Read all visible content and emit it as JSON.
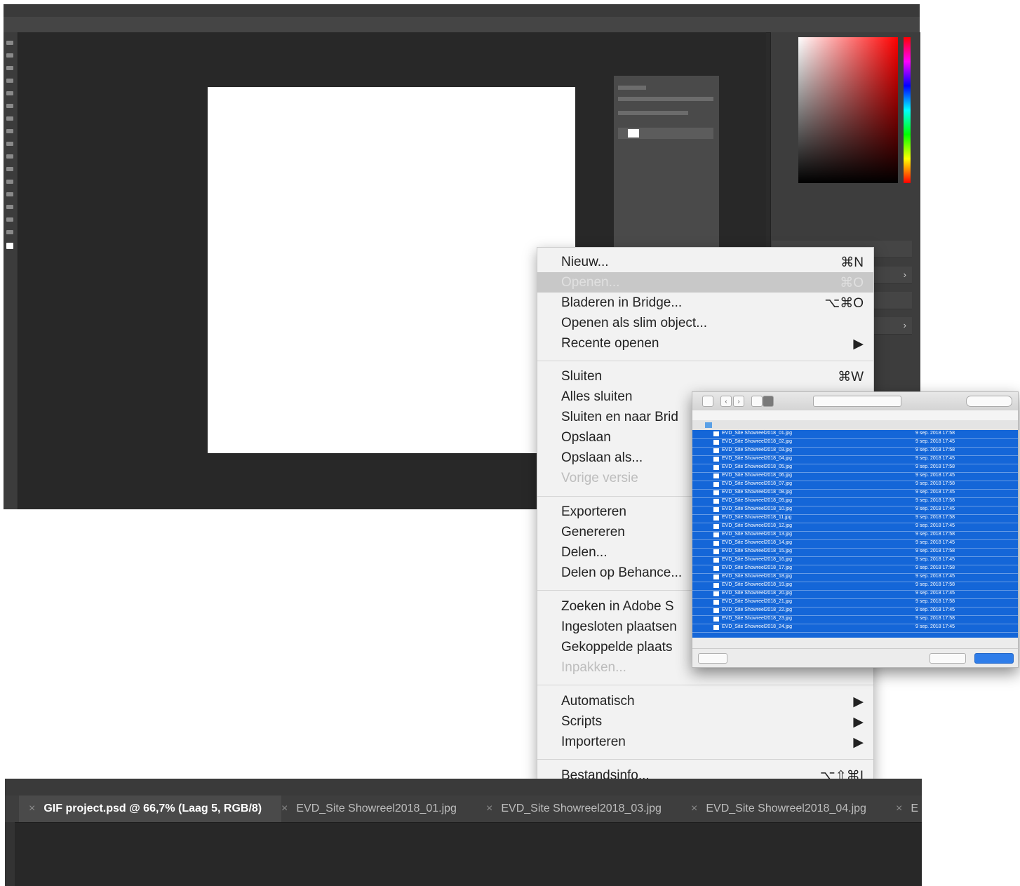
{
  "photoshop": {
    "right_dock_arrows": [
      "›",
      "›"
    ]
  },
  "file_menu": {
    "items": [
      {
        "label": "Nieuw...",
        "shortcut": "⌘N"
      },
      {
        "label": "Openen...",
        "shortcut": "⌘O"
      },
      {
        "label": "Bladeren in Bridge...",
        "shortcut": "⌥⌘O"
      },
      {
        "label": "Openen als slim object...",
        "shortcut": ""
      },
      {
        "label": "Recente openen",
        "shortcut": "▶"
      },
      {
        "label": "Sluiten",
        "shortcut": "⌘W"
      },
      {
        "label": "Alles sluiten",
        "shortcut": ""
      },
      {
        "label": "Sluiten en naar Brid",
        "shortcut": ""
      },
      {
        "label": "Opslaan",
        "shortcut": ""
      },
      {
        "label": "Opslaan als...",
        "shortcut": ""
      },
      {
        "label": "Vorige versie",
        "shortcut": ""
      },
      {
        "label": "Exporteren",
        "shortcut": ""
      },
      {
        "label": "Genereren",
        "shortcut": ""
      },
      {
        "label": "Delen...",
        "shortcut": ""
      },
      {
        "label": "Delen op Behance...",
        "shortcut": ""
      },
      {
        "label": "Zoeken in Adobe S",
        "shortcut": ""
      },
      {
        "label": "Ingesloten plaatsen",
        "shortcut": ""
      },
      {
        "label": "Gekoppelde plaats",
        "shortcut": ""
      },
      {
        "label": "Inpakken...",
        "shortcut": ""
      },
      {
        "label": "Automatisch",
        "shortcut": "▶"
      },
      {
        "label": "Scripts",
        "shortcut": "▶"
      },
      {
        "label": "Importeren",
        "shortcut": "▶"
      },
      {
        "label": "Bestandsinfo...",
        "shortcut": "⌥⇧⌘I"
      }
    ]
  },
  "open_dialog": {
    "back_label": "‹",
    "forward_label": "›",
    "files": [
      {
        "name": "EVD_Site Showreel2018_01.jpg",
        "date": "9 sep. 2018 17:58"
      },
      {
        "name": "EVD_Site Showreel2018_02.jpg",
        "date": "9 sep. 2018 17:45"
      },
      {
        "name": "EVD_Site Showreel2018_03.jpg",
        "date": "9 sep. 2018 17:58"
      },
      {
        "name": "EVD_Site Showreel2018_04.jpg",
        "date": "9 sep. 2018 17:45"
      },
      {
        "name": "EVD_Site Showreel2018_05.jpg",
        "date": "9 sep. 2018 17:58"
      },
      {
        "name": "EVD_Site Showreel2018_06.jpg",
        "date": "9 sep. 2018 17:45"
      },
      {
        "name": "EVD_Site Showreel2018_07.jpg",
        "date": "9 sep. 2018 17:58"
      },
      {
        "name": "EVD_Site Showreel2018_08.jpg",
        "date": "9 sep. 2018 17:45"
      },
      {
        "name": "EVD_Site Showreel2018_09.jpg",
        "date": "9 sep. 2018 17:58"
      },
      {
        "name": "EVD_Site Showreel2018_10.jpg",
        "date": "9 sep. 2018 17:45"
      },
      {
        "name": "EVD_Site Showreel2018_11.jpg",
        "date": "9 sep. 2018 17:58"
      },
      {
        "name": "EVD_Site Showreel2018_12.jpg",
        "date": "9 sep. 2018 17:45"
      },
      {
        "name": "EVD_Site Showreel2018_13.jpg",
        "date": "9 sep. 2018 17:58"
      },
      {
        "name": "EVD_Site Showreel2018_14.jpg",
        "date": "9 sep. 2018 17:45"
      },
      {
        "name": "EVD_Site Showreel2018_15.jpg",
        "date": "9 sep. 2018 17:58"
      },
      {
        "name": "EVD_Site Showreel2018_16.jpg",
        "date": "9 sep. 2018 17:45"
      },
      {
        "name": "EVD_Site Showreel2018_17.jpg",
        "date": "9 sep. 2018 17:58"
      },
      {
        "name": "EVD_Site Showreel2018_18.jpg",
        "date": "9 sep. 2018 17:45"
      },
      {
        "name": "EVD_Site Showreel2018_19.jpg",
        "date": "9 sep. 2018 17:58"
      },
      {
        "name": "EVD_Site Showreel2018_20.jpg",
        "date": "9 sep. 2018 17:45"
      },
      {
        "name": "EVD_Site Showreel2018_21.jpg",
        "date": "9 sep. 2018 17:58"
      },
      {
        "name": "EVD_Site Showreel2018_22.jpg",
        "date": "9 sep. 2018 17:45"
      },
      {
        "name": "EVD_Site Showreel2018_23.jpg",
        "date": "9 sep. 2018 17:58"
      },
      {
        "name": "EVD_Site Showreel2018_24.jpg",
        "date": "9 sep. 2018 17:45"
      }
    ]
  },
  "doc_tabs": [
    {
      "close": "×",
      "label": "GIF project.psd @ 66,7% (Laag 5, RGB/8)"
    },
    {
      "close": "×",
      "label": "EVD_Site Showreel2018_01.jpg"
    },
    {
      "close": "×",
      "label": "EVD_Site Showreel2018_03.jpg"
    },
    {
      "close": "×",
      "label": "EVD_Site Showreel2018_04.jpg"
    },
    {
      "close": "×",
      "label": "E"
    }
  ],
  "colors": {
    "highlight": "#1466d8",
    "ps_background": "#2b2b2b",
    "menu_background": "#f2f2f2"
  }
}
